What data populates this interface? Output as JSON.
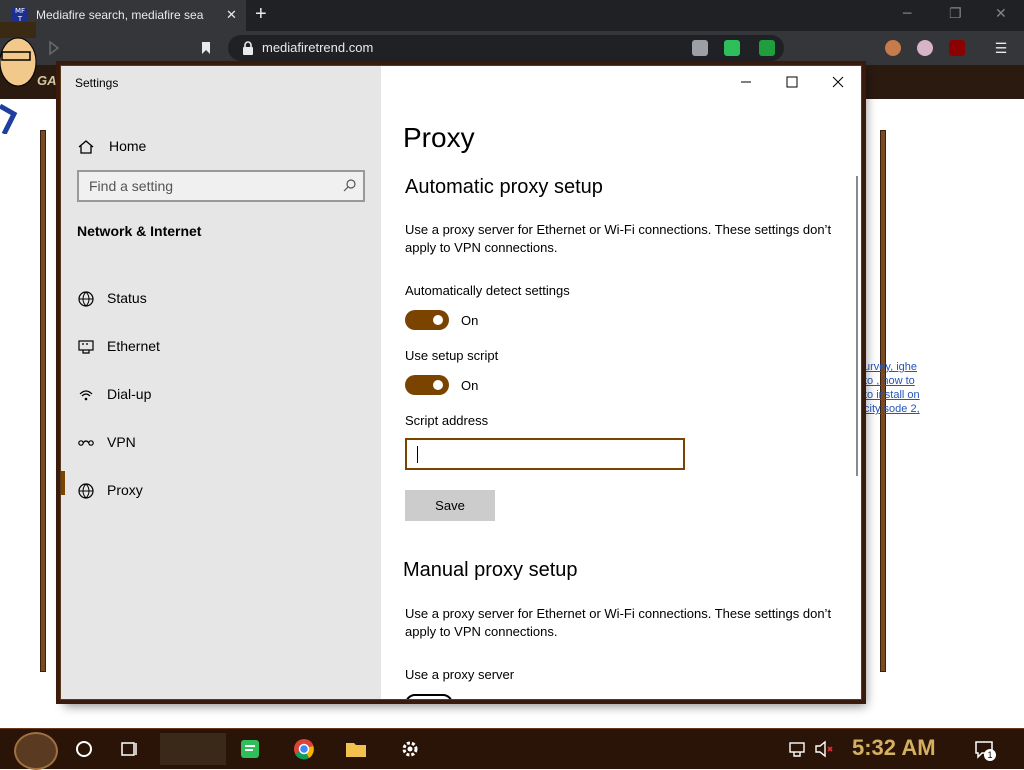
{
  "browser": {
    "tab_title": "Mediafire search, mediafire sea",
    "tab_favicon_text": "MF T",
    "url": "mediafiretrend.com",
    "page_band_text": "GA",
    "page_link_text": "urvey, ighe to , how to to install on city sode 2,"
  },
  "settings": {
    "app_title": "Settings",
    "home_label": "Home",
    "search_placeholder": "Find a setting",
    "section_title": "Network & Internet",
    "nav_items": [
      {
        "label": "Status",
        "icon": "status-globe-icon"
      },
      {
        "label": "Ethernet",
        "icon": "ethernet-icon"
      },
      {
        "label": "Dial-up",
        "icon": "dialup-icon"
      },
      {
        "label": "VPN",
        "icon": "vpn-icon"
      },
      {
        "label": "Proxy",
        "icon": "proxy-globe-icon"
      }
    ],
    "selected_nav": "Proxy",
    "page_title": "Proxy",
    "auto": {
      "heading": "Automatic proxy setup",
      "description": "Use a proxy server for Ethernet or Wi-Fi connections. These settings don’t apply to VPN connections.",
      "detect_label": "Automatically detect settings",
      "detect_state": "On",
      "script_label": "Use setup script",
      "script_state": "On",
      "address_label": "Script address",
      "address_value": "",
      "save_label": "Save"
    },
    "manual": {
      "heading": "Manual proxy setup",
      "description": "Use a proxy server for Ethernet or Wi-Fi connections. These settings don’t apply to VPN connections.",
      "use_proxy_label": "Use a proxy server"
    }
  },
  "taskbar": {
    "clock": "5:32 AM",
    "notification_count": "1"
  },
  "colors": {
    "accent": "#7a4300",
    "sidebar_bg": "#e6e6e6",
    "chrome_dark": "#202124",
    "chrome_mid": "#35363a",
    "taskbar_bg": "#2a1408",
    "clock_color": "#d4b060"
  }
}
